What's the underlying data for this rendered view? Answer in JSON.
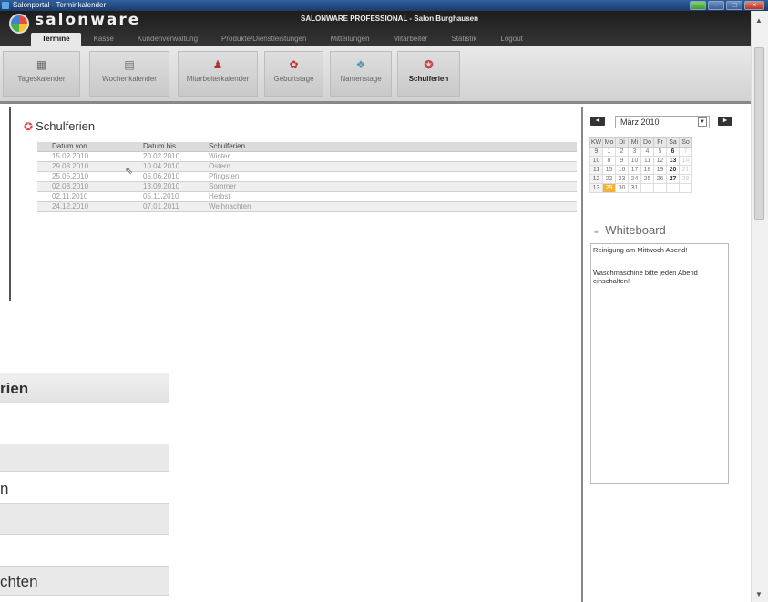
{
  "window": {
    "title": "Salonportal - Terminkalender"
  },
  "header": {
    "logo": "salonware",
    "app_title": "SALONWARE PROFESSIONAL - Salon Burghausen",
    "nav": [
      "Termine",
      "Kasse",
      "Kundenverwaltung",
      "Produkte/Dienstleistungen",
      "Mitteilungen",
      "Mitarbeiter",
      "Statistik",
      "Logout"
    ]
  },
  "toolbar": {
    "buttons": [
      "Tageskalender",
      "Wochenkalender",
      "Mitarbeiterkalender",
      "Geburtstage",
      "Namenstage",
      "Schulferien"
    ]
  },
  "main": {
    "title": "Schulferien",
    "columns": [
      "Datum von",
      "Datum bis",
      "Schulferien"
    ],
    "rows": [
      [
        "15.02.2010",
        "20.02.2010",
        "Winter"
      ],
      [
        "29.03.2010",
        "10.04.2010",
        "Ostern"
      ],
      [
        "25.05.2010",
        "05.06.2010",
        "Pfingsten"
      ],
      [
        "02.08.2010",
        "13.09.2010",
        "Sommer"
      ],
      [
        "02.11.2010",
        "05.11.2010",
        "Herbst"
      ],
      [
        "24.12.2010",
        "07.01.2011",
        "Weihnachten"
      ]
    ]
  },
  "zoom": {
    "header": "rien",
    "rows": [
      "",
      "",
      "n",
      "",
      "",
      "chten"
    ]
  },
  "calendar": {
    "month_label": "März 2010",
    "prev": "◄",
    "next": "►",
    "headers": [
      "KW",
      "Mo",
      "Di",
      "Mi",
      "Do",
      "Fr",
      "Sa",
      "So"
    ],
    "weeks": [
      [
        "9",
        "1",
        "2",
        "3",
        "4",
        "5",
        "6",
        "7"
      ],
      [
        "10",
        "8",
        "9",
        "10",
        "11",
        "12",
        "13",
        "14"
      ],
      [
        "11",
        "15",
        "16",
        "17",
        "18",
        "19",
        "20",
        "21"
      ],
      [
        "12",
        "22",
        "23",
        "24",
        "25",
        "26",
        "27",
        "28"
      ],
      [
        "13",
        "29",
        "30",
        "31",
        "",
        "",
        "",
        ""
      ]
    ],
    "today": "29"
  },
  "whiteboard": {
    "title": "Whiteboard",
    "notes": [
      "Reinigung am Mittwoch Abend!",
      "Waschmaschine bitte jeden Abend einschalten!"
    ]
  },
  "colors": {
    "accent": "#f2b233",
    "header_bg": "#222222",
    "toolbar_bg": "#d8d8d8"
  }
}
